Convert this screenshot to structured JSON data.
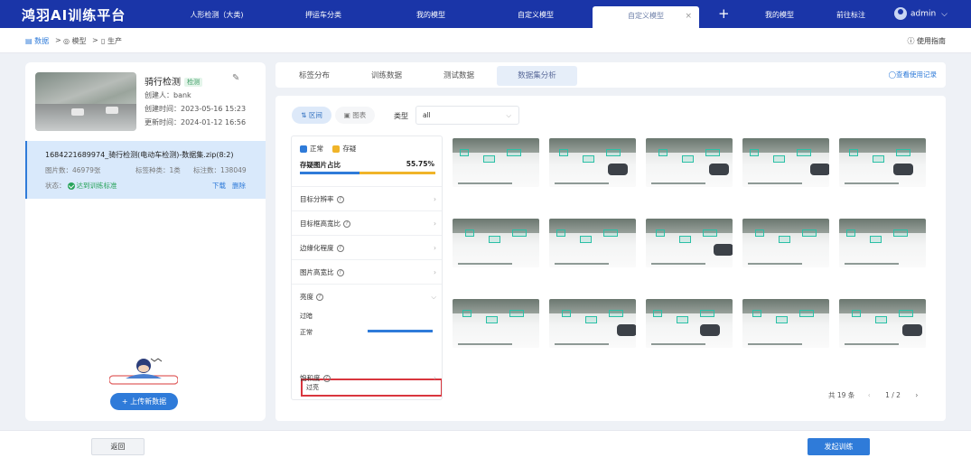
{
  "app": {
    "brand": "鸿羽AI训练平台"
  },
  "nav": {
    "tabs": [
      {
        "label": "人形检测（大类)"
      },
      {
        "label": "押运车分类"
      },
      {
        "label": "我的模型"
      },
      {
        "label": "自定义模型"
      },
      {
        "label": "自定义模型",
        "active": true,
        "close": "×"
      },
      {
        "label": "我的模型"
      },
      {
        "label": "前往标注"
      }
    ],
    "plus": "+",
    "user": "admin"
  },
  "breadcrumb": {
    "items": [
      "数据",
      "模型",
      "生产"
    ],
    "sep": ">",
    "guide": "使用指南"
  },
  "model": {
    "name": "骑行检测",
    "tag": "检测",
    "creator": "创建人：bank",
    "created": "创建时间：2023-05-16 15:23",
    "updated": "更新时间：2024-01-12 16:56"
  },
  "dataset": {
    "title": "1684221689974_骑行检测(电动车检测)-数据集.zip(8:2)",
    "image_count": "图片数：46979张",
    "label_types": "标签种类：1类",
    "label_count": "标注数：138049",
    "status_label": "状态：",
    "status_value": "达到训练标准",
    "download": "下载",
    "delete": "删除"
  },
  "upload_button": "+ 上传新数据",
  "tabs": {
    "items": [
      "标签分布",
      "训练数据",
      "测试数据",
      "数据集分析"
    ],
    "active_index": 3,
    "usage": "◯查看使用记录"
  },
  "toolbar": {
    "view_interval": "区间",
    "view_image": "图表",
    "type_label": "类型",
    "type_value": "all"
  },
  "filter": {
    "legend_normal": "正常",
    "legend_suspect": "存疑",
    "ratio_label": "存疑图片占比",
    "ratio_value": "55.75%",
    "ratio_fraction": 0.4425,
    "rows": [
      "目标分辨率",
      "目标框高宽比",
      "边缘化程度",
      "图片高宽比",
      "亮度"
    ],
    "brightness_options": [
      "过暗",
      "正常",
      "过亮"
    ],
    "saturation": "饱和度",
    "help": "?"
  },
  "pager": {
    "total": "共 19 条",
    "page": "1 / 2",
    "prev": "‹",
    "next": "›"
  },
  "footer": {
    "back": "返回",
    "train": "发起训练"
  },
  "colors": {
    "primary": "#2f7bd9",
    "nav": "#1a35a8",
    "suspect": "#f0b429",
    "highlight": "#d9363e"
  }
}
